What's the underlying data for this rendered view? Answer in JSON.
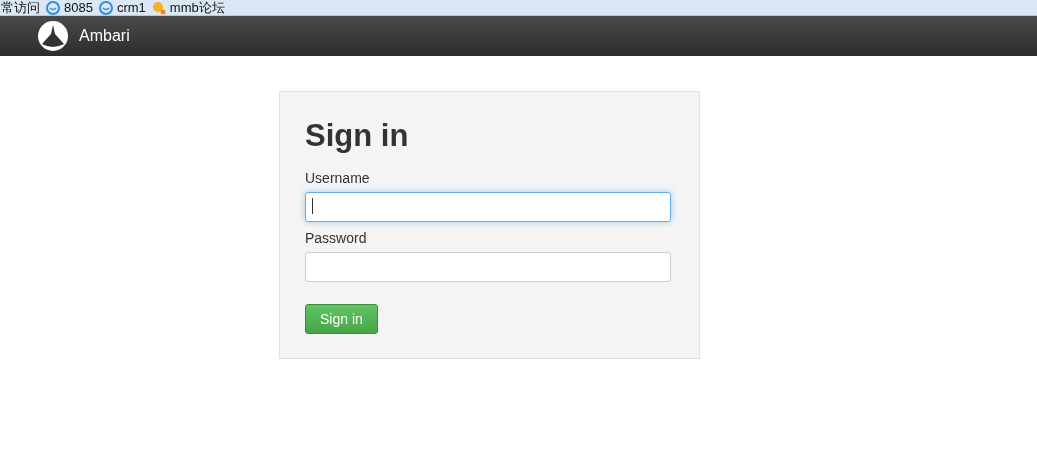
{
  "bookmarks_bar": {
    "items": [
      {
        "label": "常访问",
        "kind": "folder"
      },
      {
        "label": "8085",
        "kind": "site"
      },
      {
        "label": "crm1",
        "kind": "site"
      },
      {
        "label": "mmb论坛",
        "kind": "forum"
      }
    ]
  },
  "navbar": {
    "brand": "Ambari"
  },
  "login": {
    "title": "Sign in",
    "fields": [
      {
        "label": "Username",
        "focused": true
      },
      {
        "label": "Password",
        "focused": false
      }
    ],
    "button": "Sign in"
  }
}
